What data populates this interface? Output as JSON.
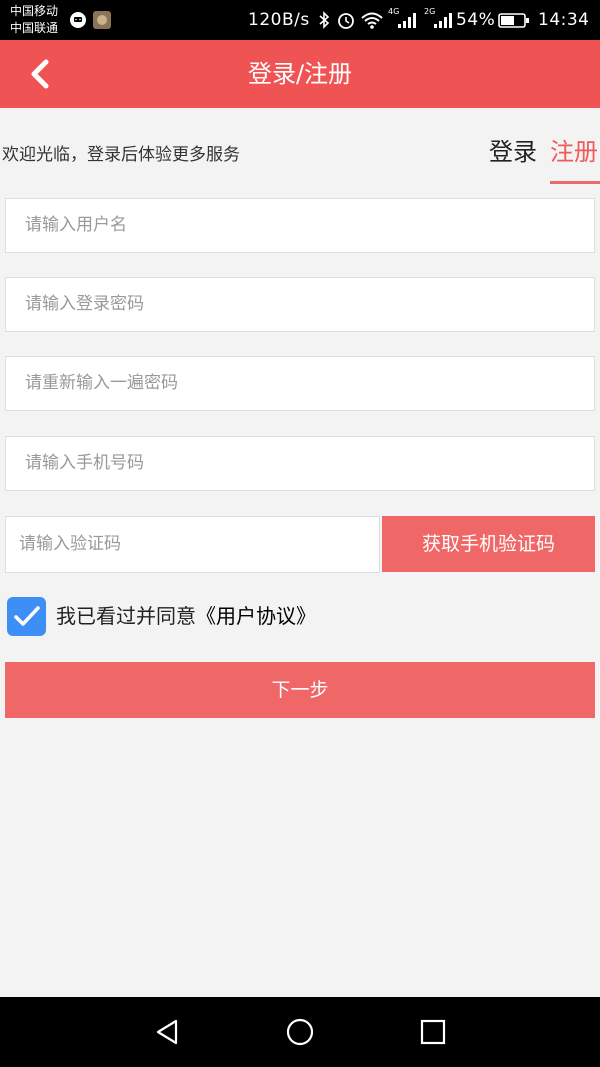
{
  "status_bar": {
    "carrier_1": "中国移动",
    "carrier_2": "中国联通",
    "net_speed": "120B/s",
    "network_4g": "4G",
    "network_2g": "2G",
    "battery": "54%",
    "time": "14:34",
    "icons": [
      "chat-icon",
      "app-icon",
      "bluetooth-icon",
      "alarm-icon",
      "wifi-icon",
      "signal-icon",
      "battery-icon"
    ]
  },
  "header": {
    "title": "登录/注册",
    "back_icon": "back-arrow-icon",
    "background": "#ef5354"
  },
  "welcome_text": "欢迎光临，登录后体验更多服务",
  "tabs": [
    {
      "label": "登录",
      "active": false
    },
    {
      "label": "注册",
      "active": true
    }
  ],
  "form": {
    "username_placeholder": "请输入用户名",
    "password_placeholder": "请输入登录密码",
    "password_repeat_placeholder": "请重新输入一遍密码",
    "phone_placeholder": "请输入手机号码",
    "code_placeholder": "请输入验证码",
    "get_code_label": "获取手机验证码"
  },
  "agreement": {
    "checked": true,
    "prefix": "我已看过并同意",
    "link": "《用户协议》"
  },
  "next_label": "下一步",
  "accent_color": "#ef6767",
  "checkbox_color": "#3d8ff5",
  "nav_bar": {
    "icons": [
      "nav-back-icon",
      "nav-home-icon",
      "nav-recents-icon"
    ]
  }
}
